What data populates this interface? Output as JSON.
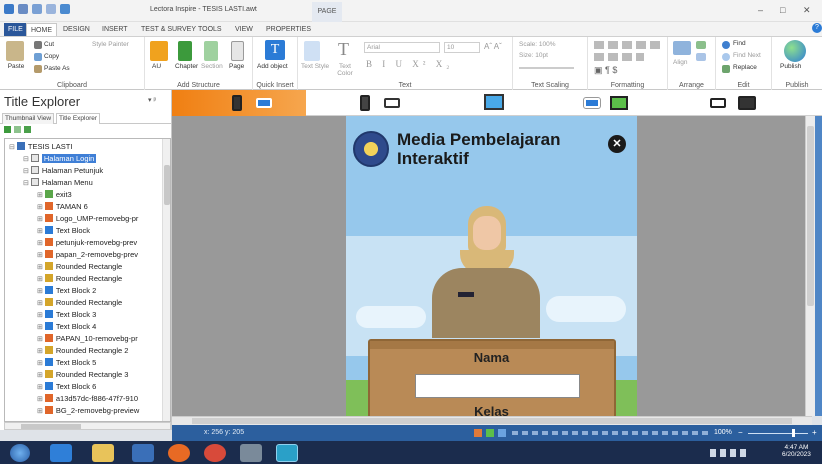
{
  "window": {
    "title": "Lectora Inspire - TESIS LASTI.awt",
    "context_tab": "PAGE",
    "minimize_glyph": "–",
    "maximize_glyph": "□",
    "close_glyph": "✕",
    "help_glyph": "?"
  },
  "ribbon_tabs": [
    "FILE",
    "HOME",
    "DESIGN",
    "INSERT",
    "TEST & SURVEY",
    "TOOLS",
    "VIEW",
    "PROPERTIES"
  ],
  "ribbon": {
    "clipboard": {
      "paste": "Paste",
      "cut": "Cut",
      "copy": "Copy",
      "paste_as": "Paste As",
      "style_painter": "Style Painter",
      "label": "Clipboard"
    },
    "add_structure": {
      "au": "AU",
      "chapter": "Chapter",
      "section": "Section",
      "page": "Page",
      "label": "Add Structure"
    },
    "quick_insert": {
      "add_object": "Add object",
      "label": "Quick Insert"
    },
    "text": {
      "text_style": "Text Style",
      "text_color": "Text Color",
      "font": "Arial",
      "size": "10",
      "label": "Text"
    },
    "text_scaling": {
      "scale": "Scale: 100%",
      "size": "Size: 10pt",
      "label": "Text Scaling"
    },
    "formatting": {
      "label": "Formatting"
    },
    "arrange": {
      "align": "Align",
      "label": "Arrange"
    },
    "edit": {
      "find": "Find",
      "find_next": "Find Next",
      "replace": "Replace",
      "label": "Edit"
    },
    "publish": {
      "button": "Publish",
      "label": "Publish"
    }
  },
  "panel": {
    "title": "Title Explorer",
    "pin_glyph": "▾ ᵖ",
    "tabs": [
      "Thumbnail View",
      "Title Explorer"
    ],
    "tree": [
      {
        "label": "TESIS LASTI",
        "level": 0,
        "icon": "title-icon",
        "selected": false
      },
      {
        "label": "Halaman Login",
        "level": 1,
        "icon": "page-icon",
        "selected": true
      },
      {
        "label": "Halaman Petunjuk",
        "level": 1,
        "icon": "page-icon",
        "selected": false
      },
      {
        "label": "Halaman Menu",
        "level": 1,
        "icon": "page-icon",
        "selected": false
      },
      {
        "label": "exit3",
        "level": 2,
        "icon": "button-icon",
        "selected": false
      },
      {
        "label": "TAMAN 6",
        "level": 2,
        "icon": "image-icon",
        "selected": false
      },
      {
        "label": "Logo_UMP-removebg-pr",
        "level": 2,
        "icon": "image-icon",
        "selected": false
      },
      {
        "label": "Text Block",
        "level": 2,
        "icon": "text-icon",
        "selected": false
      },
      {
        "label": "petunjuk-removebg-prev",
        "level": 2,
        "icon": "image-icon",
        "selected": false
      },
      {
        "label": "papan_2-removebg-prev",
        "level": 2,
        "icon": "image-icon",
        "selected": false
      },
      {
        "label": "Rounded Rectangle",
        "level": 2,
        "icon": "shape-icon",
        "selected": false
      },
      {
        "label": "Rounded Rectangle",
        "level": 2,
        "icon": "shape-icon",
        "selected": false
      },
      {
        "label": "Text Block 2",
        "level": 2,
        "icon": "text-icon",
        "selected": false
      },
      {
        "label": "Rounded Rectangle",
        "level": 2,
        "icon": "shape-icon",
        "selected": false
      },
      {
        "label": "Text Block 3",
        "level": 2,
        "icon": "text-icon",
        "selected": false
      },
      {
        "label": "Text Block 4",
        "level": 2,
        "icon": "text-icon",
        "selected": false
      },
      {
        "label": "PAPAN_10-removebg-pr",
        "level": 2,
        "icon": "image-icon",
        "selected": false
      },
      {
        "label": "Rounded Rectangle 2",
        "level": 2,
        "icon": "shape-icon",
        "selected": false
      },
      {
        "label": "Text Block 5",
        "level": 2,
        "icon": "text-icon",
        "selected": false
      },
      {
        "label": "Rounded Rectangle 3",
        "level": 2,
        "icon": "shape-icon",
        "selected": false
      },
      {
        "label": "Text Block 6",
        "level": 2,
        "icon": "text-icon",
        "selected": false
      },
      {
        "label": "a13d57dc-f886-47f7-910",
        "level": 2,
        "icon": "image-icon",
        "selected": false
      },
      {
        "label": "BG_2-removebg-preview",
        "level": 2,
        "icon": "image-icon",
        "selected": false
      }
    ]
  },
  "stage": {
    "title_line1": "Media Pembelajaran",
    "title_line2": "Interaktif",
    "close_glyph": "✕",
    "name_label": "Nama",
    "class_label": "Kelas"
  },
  "status": {
    "coords": "x: 256 y: 205",
    "zoom": "100%",
    "plus": "+",
    "minus": "−"
  },
  "taskbar": {
    "time": "4:47 AM",
    "date": "6/20/2023"
  },
  "colors": {
    "ribbon_blue": "#2b579a",
    "device_active": "#f08a1c",
    "stage_sky": "#96c8ec",
    "board": "#b98a56",
    "taskbar": "#1b2c4d"
  }
}
